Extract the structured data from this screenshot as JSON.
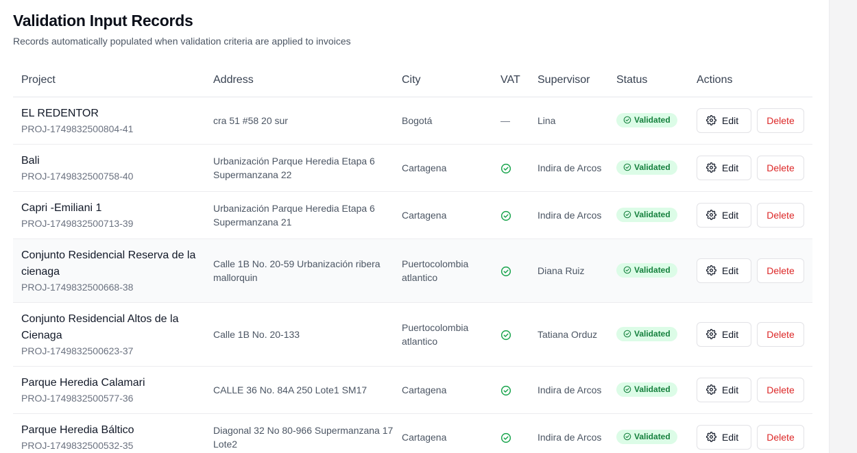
{
  "page": {
    "title": "Validation Input Records",
    "subtitle": "Records automatically populated when validation criteria are applied to invoices"
  },
  "table": {
    "headers": {
      "project": "Project",
      "address": "Address",
      "city": "City",
      "vat": "VAT",
      "supervisor": "Supervisor",
      "status": "Status",
      "actions": "Actions"
    },
    "edit_label": "Edit",
    "delete_label": "Delete",
    "rows": [
      {
        "name": "EL REDENTOR",
        "id": "PROJ-1749832500804-41",
        "address": "cra 51 #58 20 sur",
        "city": "Bogotá",
        "vat": "—",
        "vat_checked": false,
        "supervisor": "Lina",
        "status": "Validated"
      },
      {
        "name": "Bali",
        "id": "PROJ-1749832500758-40",
        "address": "Urbanización Parque Heredia Etapa 6 Supermanzana 22",
        "city": "Cartagena",
        "vat": "",
        "vat_checked": true,
        "supervisor": "Indira de Arcos",
        "status": "Validated"
      },
      {
        "name": "Capri -Emiliani 1",
        "id": "PROJ-1749832500713-39",
        "address": "Urbanización Parque Heredia Etapa 6 Supermanzana 21",
        "city": "Cartagena",
        "vat": "",
        "vat_checked": true,
        "supervisor": "Indira de Arcos",
        "status": "Validated"
      },
      {
        "name": "Conjunto Residencial Reserva de la cienaga",
        "id": "PROJ-1749832500668-38",
        "address": "Calle 1B No. 20-59 Urbanización ribera mallorquin",
        "city": "Puertocolombia atlantico",
        "vat": "",
        "vat_checked": true,
        "supervisor": "Diana Ruiz",
        "status": "Validated"
      },
      {
        "name": "Conjunto Residencial Altos de la Cienaga",
        "id": "PROJ-1749832500623-37",
        "address": "Calle 1B No. 20-133",
        "city": "Puertocolombia atlantico",
        "vat": "",
        "vat_checked": true,
        "supervisor": "Tatiana Orduz",
        "status": "Validated"
      },
      {
        "name": "Parque Heredia Calamari",
        "id": "PROJ-1749832500577-36",
        "address": "CALLE 36 No. 84A 250 Lote1 SM17",
        "city": "Cartagena",
        "vat": "",
        "vat_checked": true,
        "supervisor": "Indira de Arcos",
        "status": "Validated"
      },
      {
        "name": "Parque Heredia Báltico",
        "id": "PROJ-1749832500532-35",
        "address": "Diagonal 32 No 80-966 Supermanzana 17 Lote2",
        "city": "Cartagena",
        "vat": "",
        "vat_checked": true,
        "supervisor": "Indira de Arcos",
        "status": "Validated"
      }
    ]
  },
  "icons": {
    "vat_check": "circle-check-icon",
    "status_check": "circle-check-icon",
    "edit": "gear-icon"
  },
  "colors": {
    "status_bg": "#dcfce7",
    "status_text": "#15803d",
    "vat_check": "#16a34a",
    "delete_text": "#dc2626"
  }
}
